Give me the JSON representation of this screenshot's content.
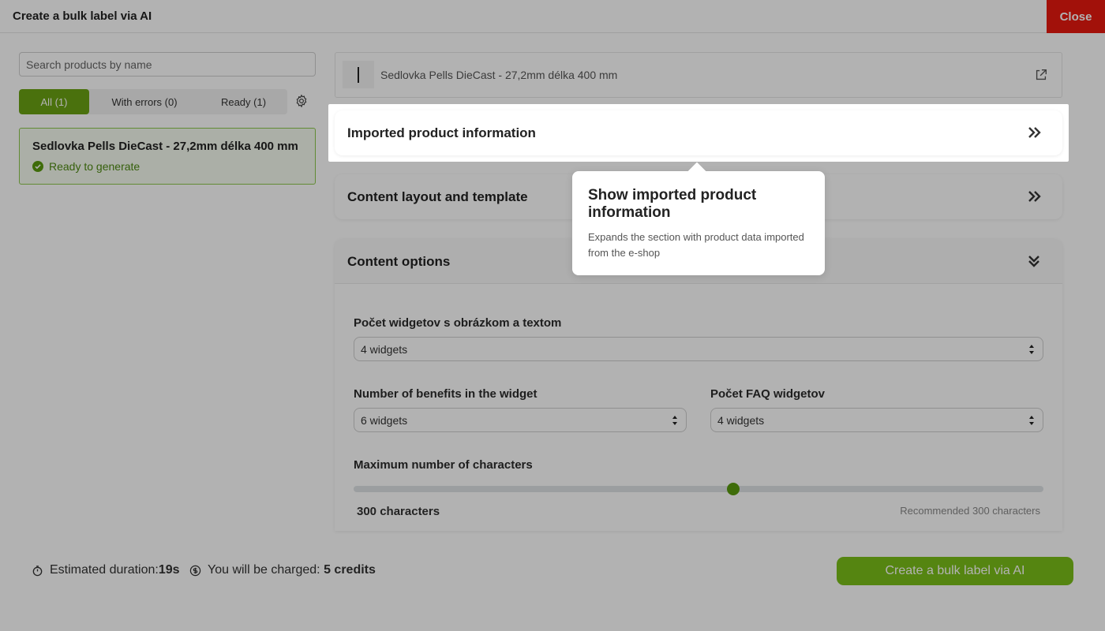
{
  "window": {
    "title": "Create a bulk label via AI",
    "close_label": "Close"
  },
  "search": {
    "placeholder": "Search products by name"
  },
  "filters": [
    {
      "label": "All (1)",
      "active": true
    },
    {
      "label": "With errors (0)",
      "active": false
    },
    {
      "label": "Ready (1)",
      "active": false
    }
  ],
  "product_list": [
    {
      "name": "Sedlovka Pells DieCast - 27,2mm délka 400 mm",
      "status": "Ready to generate"
    }
  ],
  "product_header": {
    "name": "Sedlovka Pells DieCast - 27,2mm délka 400 mm"
  },
  "sections": {
    "imported": {
      "title": "Imported product information"
    },
    "layout": {
      "title": "Content layout and template"
    },
    "options": {
      "title": "Content options"
    }
  },
  "options": {
    "image_text_widgets": {
      "label": "Počet widgetov s obrázkom a textom",
      "value": "4 widgets"
    },
    "benefits": {
      "label": "Number of benefits in the widget",
      "value": "6 widgets"
    },
    "faq": {
      "label": "Počet FAQ widgetov",
      "value": "4 widgets"
    },
    "max_chars": {
      "label": "Maximum number of characters",
      "value_label": "300 characters",
      "recommended": "Recommended 300 characters",
      "level": 0.55
    }
  },
  "tooltip": {
    "title": "Show imported product information",
    "description": "Expands the section with product data imported from the e-shop"
  },
  "footer": {
    "duration_label": "Estimated duration:",
    "duration_value": "19s",
    "charge_label": "You will be charged:",
    "charge_value": "5 credits",
    "cta_label": "Create a bulk label via AI"
  },
  "colors": {
    "accent": "#6aa313",
    "close": "#e8190f",
    "status_ok": "#4e8a12"
  }
}
